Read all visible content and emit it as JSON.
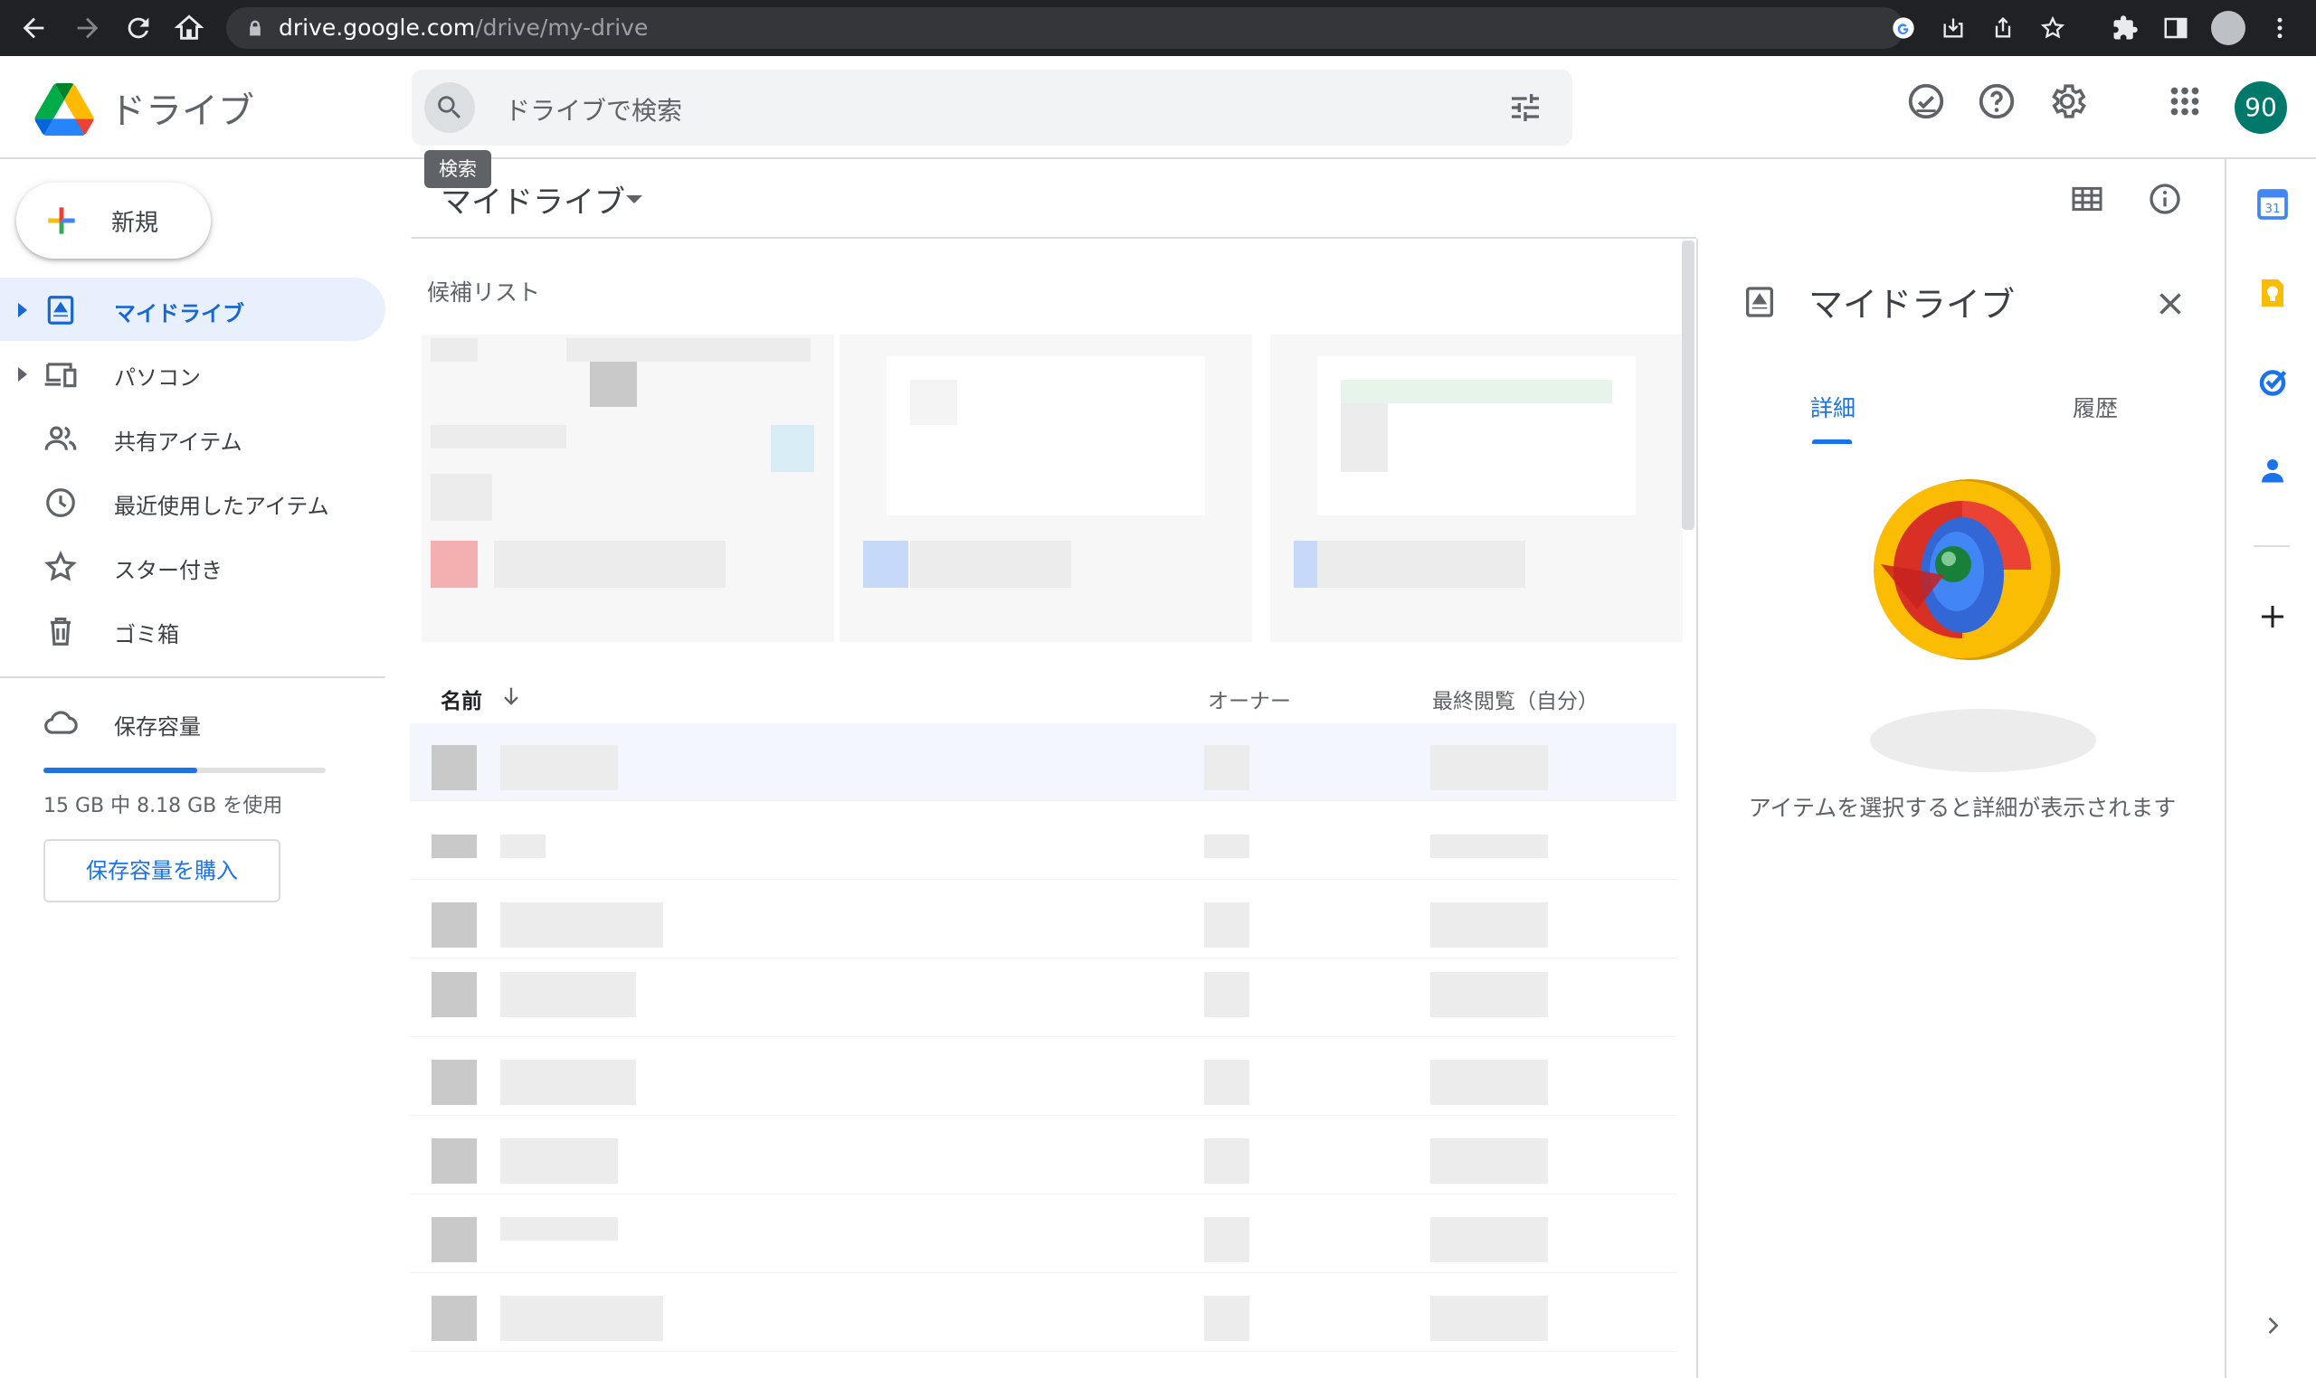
{
  "browser": {
    "url_host": "drive.google.com",
    "url_path": "/drive/my-drive"
  },
  "header": {
    "app_name": "ドライブ",
    "search_placeholder": "ドライブで検索",
    "search_tooltip": "検索",
    "avatar_text": "90"
  },
  "sidebar": {
    "new_label": "新規",
    "items": [
      {
        "label": "マイドライブ",
        "icon": "my-drive-icon",
        "active": true
      },
      {
        "label": "パソコン",
        "icon": "computers-icon"
      },
      {
        "label": "共有アイテム",
        "icon": "shared-icon"
      },
      {
        "label": "最近使用したアイテム",
        "icon": "recent-icon"
      },
      {
        "label": "スター付き",
        "icon": "star-icon"
      },
      {
        "label": "ゴミ箱",
        "icon": "trash-icon"
      }
    ],
    "storage": {
      "label": "保存容量",
      "usage_text": "15 GB 中 8.18 GB を使用",
      "used_fraction": 0.545,
      "buy_label": "保存容量を購入"
    }
  },
  "main": {
    "breadcrumb": "マイドライブ",
    "suggested_title": "候補リスト",
    "columns": {
      "name": "名前",
      "owner": "オーナー",
      "last_viewed": "最終閲覧（自分）"
    }
  },
  "details_panel": {
    "title": "マイドライブ",
    "tab_details": "詳細",
    "tab_history": "履歴",
    "empty_message": "アイテムを選択すると詳細が表示されます"
  },
  "colors": {
    "accent": "#1a73e8",
    "active_bg": "#e8f0fe",
    "avatar_bg": "#00796b"
  }
}
